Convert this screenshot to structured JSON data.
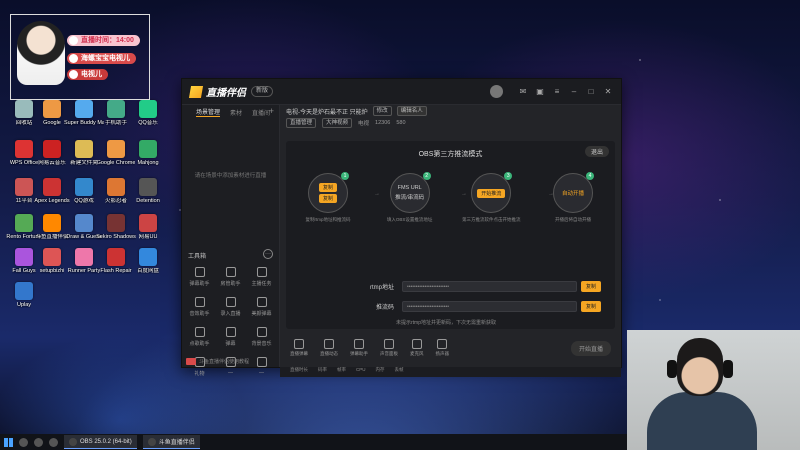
{
  "desktop": {
    "icons": [
      {
        "label": "回收站",
        "color": "#9bb"
      },
      {
        "label": "Google",
        "color": "#e94"
      },
      {
        "label": "Super Buddy Man",
        "color": "#5ae"
      },
      {
        "label": "手机助手",
        "color": "#4a8"
      },
      {
        "label": "QQ音乐",
        "color": "#2c8"
      },
      {
        "label": "WPS Office",
        "color": "#d33"
      },
      {
        "label": "网易云音乐",
        "color": "#c22"
      },
      {
        "label": "新建文件夹",
        "color": "#db5"
      },
      {
        "label": "Google Chrome",
        "color": "#e94"
      },
      {
        "label": "Mahjong",
        "color": "#3a6"
      },
      {
        "label": "11平台",
        "color": "#c55"
      },
      {
        "label": "Apex Legends",
        "color": "#c33"
      },
      {
        "label": "QQ游戏",
        "color": "#38c"
      },
      {
        "label": "火影忍者",
        "color": "#d73"
      },
      {
        "label": "Detention",
        "color": "#555"
      },
      {
        "label": "Rento Fortune",
        "color": "#5a5"
      },
      {
        "label": "斗鱼直播伴侣",
        "color": "#f80"
      },
      {
        "label": "Draw & Guess",
        "color": "#58c"
      },
      {
        "label": "Sekiro Shadows",
        "color": "#733"
      },
      {
        "label": "网易UU",
        "color": "#c44"
      },
      {
        "label": "Fall Guys",
        "color": "#a5d"
      },
      {
        "label": "setupbizhi",
        "color": "#d55"
      },
      {
        "label": "Runner Party",
        "color": "#e7a"
      },
      {
        "label": "Flash Repair",
        "color": "#c33"
      },
      {
        "label": "百度网盘",
        "color": "#38d"
      },
      {
        "label": "Uplay",
        "color": "#37c"
      }
    ]
  },
  "overlay": {
    "line1": "直播时间：14:00",
    "line2": "海螺宝宝电视儿",
    "line3": "电视儿"
  },
  "app": {
    "logo": "直播伴侣",
    "version": "新版",
    "sidebar": {
      "tabs": [
        "场景管理",
        "素材",
        "直播间"
      ],
      "empty_text": "请在场景中添加素材进行直播",
      "tools_title": "工具箱",
      "tools": [
        "弹幕助手",
        "房管助手",
        "主播任务",
        "音效助手",
        "录入直播",
        "美颜弹幕",
        "点歌助手",
        "弹幕",
        "背景音乐",
        "礼物",
        "—",
        "—"
      ],
      "bottom_text": "斗鱼直播伴侣使用教程"
    },
    "header": {
      "title": "电视-今天是炉石最不正 只能炉",
      "chip1": "修改",
      "chip2": "编辑名人",
      "chip3": "直播管理",
      "chip4": "大神视频",
      "meta1": "电视",
      "meta2": "12306",
      "meta3": "580"
    },
    "obs": {
      "title": "OBS第三方推流模式",
      "exit": "退出",
      "steps": [
        {
          "num": "1",
          "pill_a": "复制",
          "pill_b": "复制",
          "desc": "复制rtmp地址和推流码"
        },
        {
          "num": "2",
          "line_a": "FMS URL",
          "line_b": "推流/串流码",
          "desc": "填入OBS设置推流地址"
        },
        {
          "num": "3",
          "pill_a": "开始推流",
          "desc": "第三方推流软件点击开始推流"
        },
        {
          "num": "4",
          "line_a": "自动开播",
          "desc": "开播后将自动开播"
        }
      ],
      "rtmp_label": "rtmp地址",
      "rtmp_value": "••••••••••••••••••••••••",
      "key_label": "推流码",
      "key_value": "••••••••••••••••••••••••",
      "copy": "复制",
      "hint": "未提示rtmp地址并更新码，下次无需重新获取"
    },
    "bottom": {
      "items": [
        "直播弹幕",
        "直播动态",
        "弹幕助手",
        "声音面板",
        "麦克风",
        "扬声器"
      ],
      "start": "开始直播"
    },
    "status": [
      "直播时长",
      "码率",
      "帧率",
      "CPU",
      "内存",
      "丢帧"
    ]
  },
  "taskbar": {
    "tasks": [
      "OBS 25.0.2 (64-bit)",
      "斗鱼直播伴侣"
    ]
  }
}
